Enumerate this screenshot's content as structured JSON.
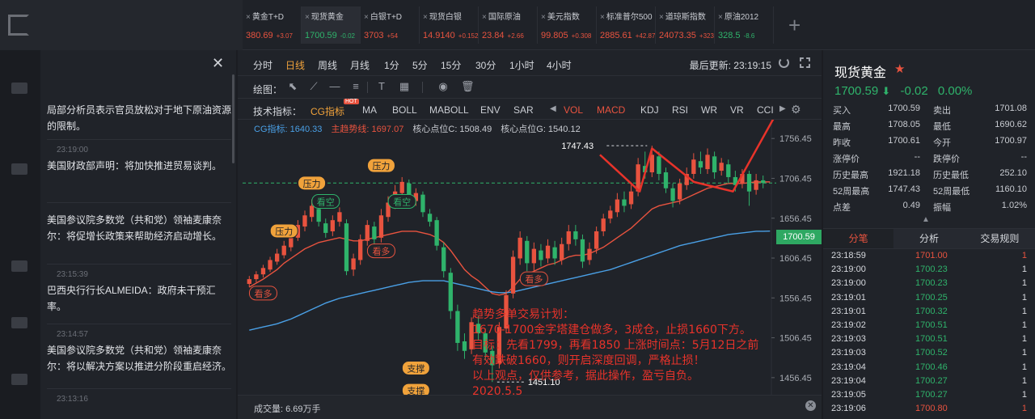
{
  "colors": {
    "up": "#e8533f",
    "down": "#2fb36b",
    "accent": "#f0a23b",
    "cg_line": "#4aa0e6",
    "plan_text": "#e8332a"
  },
  "tickers": [
    {
      "name": "黄金T+D",
      "price": "380.69",
      "change": "+3.07",
      "dir": "up"
    },
    {
      "name": "现货黄金",
      "price": "1700.59",
      "change": "-0.02",
      "dir": "down",
      "active": true
    },
    {
      "name": "白银T+D",
      "price": "3703",
      "change": "+54",
      "dir": "up"
    },
    {
      "name": "现货白银",
      "price": "14.9140",
      "change": "+0.152",
      "dir": "up"
    },
    {
      "name": "国际原油",
      "price": "23.84",
      "change": "+2.66",
      "dir": "up"
    },
    {
      "name": "美元指数",
      "price": "99.805",
      "change": "+0.308",
      "dir": "up"
    },
    {
      "name": "标准普尔500",
      "price": "2885.61",
      "change": "+42.87",
      "dir": "up"
    },
    {
      "name": "道琼斯指数",
      "price": "24073.35",
      "change": "+323",
      "dir": "up"
    },
    {
      "name": "原油2012",
      "price": "328.5",
      "change": "-8.6",
      "dir": "down"
    }
  ],
  "news": {
    "items": [
      {
        "time": "",
        "text": "局部分析员表示官员放松对于地下原油资源的限制。"
      },
      {
        "time": "23:19:00",
        "text": "美国财政部声明：将加快推进贸易谈判。"
      },
      {
        "time": "",
        "text": "美国参议院多数党（共和党）领袖麦康奈尔：将促增长政策来帮助经济启动增长。"
      },
      {
        "time": "23:15:39",
        "text": "巴西央行行长ALMEIDA：政府未干预汇率。"
      },
      {
        "time": "23:14:57",
        "text": "美国参议院多数党（共和党）领袖麦康奈尔：将以解决方案以推进分阶段重启经济。"
      },
      {
        "time": "23:13:16",
        "text": ""
      }
    ]
  },
  "periods": [
    "分时",
    "日线",
    "周线",
    "月线",
    "1分",
    "5分",
    "15分",
    "30分",
    "1小时",
    "4小时"
  ],
  "active_period": "日线",
  "last_update": "最后更新: 23:19:15",
  "draw_label": "绘图：",
  "indicator_label": "技术指标：",
  "indicators_left": [
    "CG指标",
    "MA",
    "BOLL",
    "MABOLL",
    "ENV",
    "SAR"
  ],
  "indicators_right": [
    "VOL",
    "MACD",
    "KDJ",
    "RSI",
    "WR",
    "VR",
    "CCI"
  ],
  "hot_badge": "HOT",
  "legend": {
    "cg": "CG指标: 1640.33",
    "main": "主趋势线: 1697.07",
    "pivot_c": "核心点位C: 1508.49",
    "pivot_g": "核心点位G: 1540.12"
  },
  "current_price_tag": "1700.59",
  "volume_label": "成交量: 6.69万手",
  "plan": [
    "趋势多单交易计划：",
    "1670-1700金字塔建仓做多，3成仓，止损1660下方。",
    "目标：先看1799，再看1850 上涨时间点：5月12日之前",
    "有效跌破1660，则开启深度回调，严格止损！",
    "以上观点，仅供参考，据此操作，盈亏自负。",
    "2020.5.5"
  ],
  "chart_data": {
    "type": "candlestick",
    "y_ticks": [
      "1756.45",
      "1706.45",
      "1656.45",
      "1606.45",
      "1556.45",
      "1506.45",
      "1456.45"
    ],
    "ylim": [
      1435,
      1780
    ],
    "current_price": 1700.59,
    "annotations": {
      "high_label": "1747.43",
      "low_label": "1451.10",
      "pressure": [
        "压力",
        "压力",
        "压力"
      ],
      "bear": [
        "看空",
        "看空"
      ],
      "bull": [
        "看多",
        "看多",
        "看多"
      ],
      "support": [
        "支撑",
        "支撑"
      ]
    },
    "candles": [
      {
        "o": 1574,
        "c": 1580,
        "h": 1584,
        "l": 1570
      },
      {
        "o": 1580,
        "c": 1586,
        "h": 1590,
        "l": 1576
      },
      {
        "o": 1586,
        "c": 1594,
        "h": 1598,
        "l": 1582
      },
      {
        "o": 1592,
        "c": 1604,
        "h": 1608,
        "l": 1589
      },
      {
        "o": 1602,
        "c": 1612,
        "h": 1618,
        "l": 1598
      },
      {
        "o": 1610,
        "c": 1622,
        "h": 1628,
        "l": 1606
      },
      {
        "o": 1620,
        "c": 1634,
        "h": 1640,
        "l": 1615
      },
      {
        "o": 1632,
        "c": 1648,
        "h": 1654,
        "l": 1628
      },
      {
        "o": 1646,
        "c": 1660,
        "h": 1666,
        "l": 1640
      },
      {
        "o": 1658,
        "c": 1672,
        "h": 1680,
        "l": 1652
      },
      {
        "o": 1668,
        "c": 1652,
        "h": 1676,
        "l": 1646
      },
      {
        "o": 1650,
        "c": 1638,
        "h": 1656,
        "l": 1632
      },
      {
        "o": 1640,
        "c": 1654,
        "h": 1660,
        "l": 1634
      },
      {
        "o": 1652,
        "c": 1664,
        "h": 1670,
        "l": 1646
      },
      {
        "o": 1650,
        "c": 1590,
        "h": 1655,
        "l": 1585
      },
      {
        "o": 1592,
        "c": 1606,
        "h": 1612,
        "l": 1584
      },
      {
        "o": 1604,
        "c": 1630,
        "h": 1636,
        "l": 1598
      },
      {
        "o": 1628,
        "c": 1648,
        "h": 1654,
        "l": 1622
      },
      {
        "o": 1646,
        "c": 1630,
        "h": 1652,
        "l": 1622
      },
      {
        "o": 1632,
        "c": 1660,
        "h": 1668,
        "l": 1626
      },
      {
        "o": 1658,
        "c": 1676,
        "h": 1684,
        "l": 1652
      },
      {
        "o": 1676,
        "c": 1690,
        "h": 1698,
        "l": 1668
      },
      {
        "o": 1688,
        "c": 1702,
        "h": 1708,
        "l": 1680
      },
      {
        "o": 1700,
        "c": 1676,
        "h": 1705,
        "l": 1670
      },
      {
        "o": 1678,
        "c": 1688,
        "h": 1694,
        "l": 1672
      },
      {
        "o": 1686,
        "c": 1664,
        "h": 1690,
        "l": 1658
      },
      {
        "o": 1662,
        "c": 1652,
        "h": 1668,
        "l": 1646
      },
      {
        "o": 1654,
        "c": 1622,
        "h": 1658,
        "l": 1616
      },
      {
        "o": 1620,
        "c": 1590,
        "h": 1626,
        "l": 1582
      },
      {
        "o": 1588,
        "c": 1540,
        "h": 1594,
        "l": 1530
      },
      {
        "o": 1540,
        "c": 1500,
        "h": 1548,
        "l": 1490
      },
      {
        "o": 1502,
        "c": 1490,
        "h": 1512,
        "l": 1480
      },
      {
        "o": 1492,
        "c": 1526,
        "h": 1532,
        "l": 1486
      },
      {
        "o": 1524,
        "c": 1512,
        "h": 1534,
        "l": 1504
      },
      {
        "o": 1512,
        "c": 1488,
        "h": 1518,
        "l": 1478
      },
      {
        "o": 1490,
        "c": 1472,
        "h": 1496,
        "l": 1451
      },
      {
        "o": 1474,
        "c": 1520,
        "h": 1526,
        "l": 1468
      },
      {
        "o": 1518,
        "c": 1560,
        "h": 1566,
        "l": 1512
      },
      {
        "o": 1562,
        "c": 1608,
        "h": 1616,
        "l": 1556
      },
      {
        "o": 1606,
        "c": 1632,
        "h": 1640,
        "l": 1598
      },
      {
        "o": 1628,
        "c": 1600,
        "h": 1634,
        "l": 1590
      },
      {
        "o": 1600,
        "c": 1618,
        "h": 1626,
        "l": 1590
      },
      {
        "o": 1616,
        "c": 1604,
        "h": 1624,
        "l": 1596
      },
      {
        "o": 1606,
        "c": 1622,
        "h": 1630,
        "l": 1600
      },
      {
        "o": 1620,
        "c": 1606,
        "h": 1628,
        "l": 1598
      },
      {
        "o": 1604,
        "c": 1624,
        "h": 1632,
        "l": 1598
      },
      {
        "o": 1624,
        "c": 1640,
        "h": 1648,
        "l": 1616
      },
      {
        "o": 1640,
        "c": 1630,
        "h": 1648,
        "l": 1622
      },
      {
        "o": 1630,
        "c": 1602,
        "h": 1636,
        "l": 1594
      },
      {
        "o": 1604,
        "c": 1618,
        "h": 1626,
        "l": 1598
      },
      {
        "o": 1618,
        "c": 1640,
        "h": 1646,
        "l": 1612
      },
      {
        "o": 1640,
        "c": 1656,
        "h": 1662,
        "l": 1634
      },
      {
        "o": 1656,
        "c": 1666,
        "h": 1672,
        "l": 1650
      },
      {
        "o": 1664,
        "c": 1680,
        "h": 1688,
        "l": 1658
      },
      {
        "o": 1680,
        "c": 1672,
        "h": 1690,
        "l": 1664
      },
      {
        "o": 1674,
        "c": 1690,
        "h": 1698,
        "l": 1668
      },
      {
        "o": 1690,
        "c": 1724,
        "h": 1732,
        "l": 1684
      },
      {
        "o": 1722,
        "c": 1714,
        "h": 1740,
        "l": 1706
      },
      {
        "o": 1714,
        "c": 1736,
        "h": 1747.43,
        "l": 1708
      },
      {
        "o": 1734,
        "c": 1712,
        "h": 1740,
        "l": 1704
      },
      {
        "o": 1714,
        "c": 1694,
        "h": 1720,
        "l": 1688
      },
      {
        "o": 1694,
        "c": 1678,
        "h": 1700,
        "l": 1670
      },
      {
        "o": 1680,
        "c": 1700,
        "h": 1706,
        "l": 1674
      },
      {
        "o": 1698,
        "c": 1712,
        "h": 1720,
        "l": 1692
      },
      {
        "o": 1712,
        "c": 1730,
        "h": 1738,
        "l": 1706
      },
      {
        "o": 1728,
        "c": 1720,
        "h": 1740,
        "l": 1712
      },
      {
        "o": 1718,
        "c": 1736,
        "h": 1744,
        "l": 1712
      },
      {
        "o": 1734,
        "c": 1714,
        "h": 1740,
        "l": 1706
      },
      {
        "o": 1716,
        "c": 1726,
        "h": 1732,
        "l": 1710
      },
      {
        "o": 1724,
        "c": 1708,
        "h": 1730,
        "l": 1700
      },
      {
        "o": 1708,
        "c": 1698,
        "h": 1716,
        "l": 1690
      },
      {
        "o": 1700,
        "c": 1712,
        "h": 1718,
        "l": 1694
      },
      {
        "o": 1712,
        "c": 1690,
        "h": 1716,
        "l": 1672
      },
      {
        "o": 1692,
        "c": 1704,
        "h": 1712,
        "l": 1686
      },
      {
        "o": 1704,
        "c": 1700.59,
        "h": 1710,
        "l": 1694
      }
    ],
    "series": [
      {
        "name": "主趋势线",
        "values": [
          1570,
          1575,
          1580,
          1586,
          1592,
          1600,
          1606,
          1612,
          1618,
          1622,
          1626,
          1628,
          1630,
          1632,
          1630,
          1628,
          1628,
          1630,
          1632,
          1634,
          1636,
          1638,
          1640,
          1640,
          1640,
          1638,
          1636,
          1632,
          1626,
          1616,
          1604,
          1592,
          1584,
          1578,
          1570,
          1562,
          1560,
          1562,
          1570,
          1580,
          1586,
          1590,
          1594,
          1598,
          1600,
          1604,
          1608,
          1610,
          1610,
          1612,
          1616,
          1620,
          1626,
          1632,
          1638,
          1644,
          1652,
          1660,
          1668,
          1672,
          1674,
          1676,
          1678,
          1682,
          1686,
          1690,
          1694,
          1696,
          1698,
          1700,
          1700,
          1700,
          1701,
          1702,
          1702,
          1702
        ]
      },
      {
        "name": "CG指标",
        "values": [
          1516,
          1518,
          1520,
          1522,
          1524,
          1527,
          1530,
          1534,
          1538,
          1542,
          1546,
          1550,
          1553,
          1556,
          1558,
          1560,
          1562,
          1564,
          1566,
          1568,
          1570,
          1572,
          1574,
          1576,
          1577,
          1578,
          1578,
          1578,
          1578,
          1576,
          1574,
          1572,
          1570,
          1568,
          1566,
          1564,
          1563,
          1563,
          1564,
          1566,
          1568,
          1570,
          1572,
          1574,
          1576,
          1578,
          1580,
          1582,
          1584,
          1586,
          1588,
          1590,
          1592,
          1595,
          1598,
          1601,
          1604,
          1607,
          1610,
          1613,
          1616,
          1619,
          1622,
          1624,
          1626,
          1628,
          1630,
          1632,
          1634,
          1636,
          1637,
          1638,
          1639,
          1640,
          1640,
          1640.33
        ]
      }
    ]
  },
  "quote": {
    "title": "现货黄金",
    "price": "1700.59",
    "change": "-0.02",
    "change_pct": "0.00%",
    "rows": [
      {
        "k1": "买入",
        "v1": "1700.59",
        "k2": "卖出",
        "v2": "1701.08"
      },
      {
        "k1": "最高",
        "v1": "1708.05",
        "k2": "最低",
        "v2": "1690.62"
      },
      {
        "k1": "昨收",
        "v1": "1700.61",
        "k2": "今开",
        "v2": "1700.97"
      },
      {
        "k1": "涨停价",
        "v1": "--",
        "k2": "跌停价",
        "v2": "--"
      },
      {
        "k1": "历史最高",
        "v1": "1921.18",
        "k2": "历史最低",
        "v2": "252.10"
      },
      {
        "k1": "52周最高",
        "v1": "1747.43",
        "k2": "52周最低",
        "v2": "1160.10"
      },
      {
        "k1": "点差",
        "v1": "0.49",
        "k2": "振幅",
        "v2": "1.02%"
      }
    ],
    "tabs": [
      "分笔",
      "分析",
      "交易规则"
    ],
    "ticks": [
      {
        "time": "23:18:59",
        "price": "1701.00",
        "dir": "up",
        "vol": "1"
      },
      {
        "time": "23:19:00",
        "price": "1700.23",
        "dir": "down",
        "vol": "1"
      },
      {
        "time": "23:19:00",
        "price": "1700.23",
        "dir": "down",
        "vol": "1"
      },
      {
        "time": "23:19:01",
        "price": "1700.25",
        "dir": "down",
        "vol": "1"
      },
      {
        "time": "23:19:01",
        "price": "1700.32",
        "dir": "down",
        "vol": "1"
      },
      {
        "time": "23:19:02",
        "price": "1700.51",
        "dir": "down",
        "vol": "1"
      },
      {
        "time": "23:19:03",
        "price": "1700.51",
        "dir": "down",
        "vol": "1"
      },
      {
        "time": "23:19:03",
        "price": "1700.52",
        "dir": "down",
        "vol": "1"
      },
      {
        "time": "23:19:04",
        "price": "1700.46",
        "dir": "down",
        "vol": "1"
      },
      {
        "time": "23:19:04",
        "price": "1700.27",
        "dir": "down",
        "vol": "1"
      },
      {
        "time": "23:19:05",
        "price": "1700.27",
        "dir": "down",
        "vol": "1"
      },
      {
        "time": "23:19:06",
        "price": "1700.80",
        "dir": "up",
        "vol": "1"
      }
    ]
  }
}
